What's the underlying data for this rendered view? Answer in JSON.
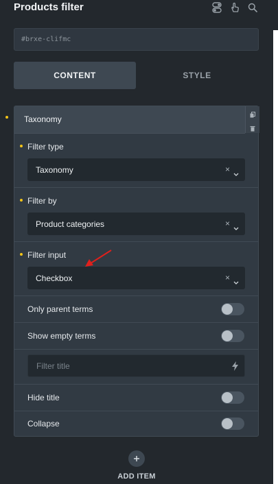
{
  "header": {
    "title": "Products filter"
  },
  "element_id": {
    "value": "#brxe-clifmc"
  },
  "tabs": [
    {
      "label": "CONTENT"
    },
    {
      "label": "STYLE"
    }
  ],
  "item": {
    "label": "Taxonomy",
    "filter_type": {
      "label": "Filter type",
      "value": "Taxonomy"
    },
    "filter_by": {
      "label": "Filter by",
      "value": "Product categories"
    },
    "filter_input": {
      "label": "Filter input",
      "value": "Checkbox"
    },
    "only_parent_terms": {
      "label": "Only parent terms",
      "enabled": false
    },
    "show_empty_terms": {
      "label": "Show empty terms",
      "enabled": false
    },
    "filter_title": {
      "placeholder": "Filter title"
    },
    "hide_title": {
      "label": "Hide title",
      "enabled": false
    },
    "collapse": {
      "label": "Collapse",
      "enabled": false
    }
  },
  "clear_symbol": "×",
  "add_item": {
    "label": "ADD ITEM"
  },
  "colors": {
    "accent_dot": "#f5c518",
    "annotation_arrow": "#e0201c"
  },
  "icons": [
    "toggle-icon",
    "pointer-hand-icon",
    "search-icon",
    "copy-icon",
    "trash-icon",
    "chevron-down-icon",
    "bolt-icon",
    "plus-icon"
  ]
}
